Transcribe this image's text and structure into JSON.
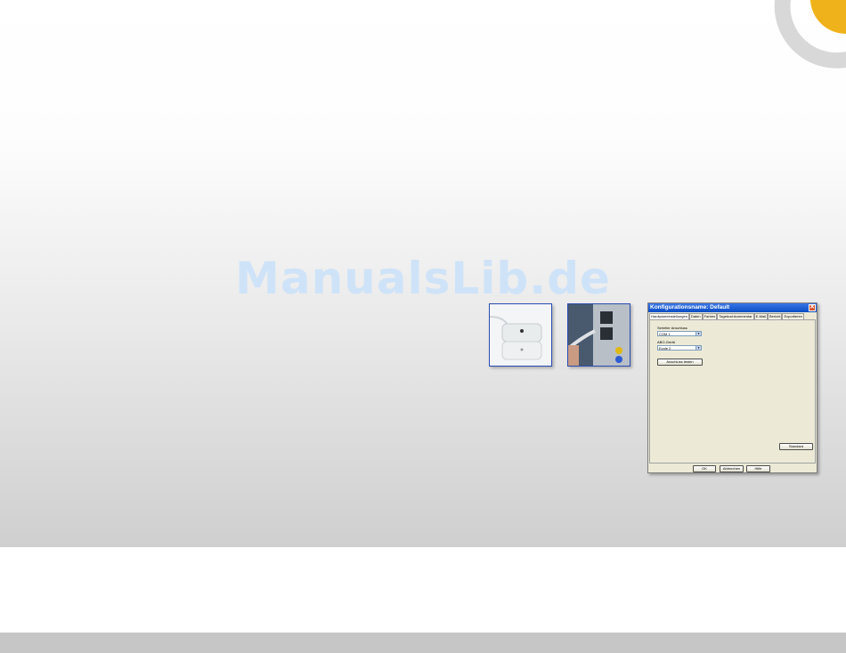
{
  "watermark": "ManualsLib.de",
  "colors": {
    "accent_yellow": "#f0b21a",
    "ring_gray": "#d8d8d8",
    "photo_border": "#2a4bb3",
    "titlebar_blue": "#0b4ec4"
  },
  "dialog": {
    "title": "Konfigurationsname: Default",
    "close_glyph": "✕",
    "tabs": [
      "Hardwareeinstellungen",
      "Daten",
      "Farben",
      "Tagebuchkommentar",
      "E-Mail",
      "Bericht",
      "Exportieren"
    ],
    "serial_label": "Serieller Anschluss",
    "serial_value": "COM 1",
    "abo_label": "ABO-Gerät",
    "abo_value": "Ecole 2",
    "test_button": "Anschluss testen",
    "standard_button": "Standard",
    "ok_button": "OK",
    "cancel_button": "Abbrechen",
    "help_button": "Hilfe",
    "dropdown_icon": "chevron-down-icon"
  }
}
